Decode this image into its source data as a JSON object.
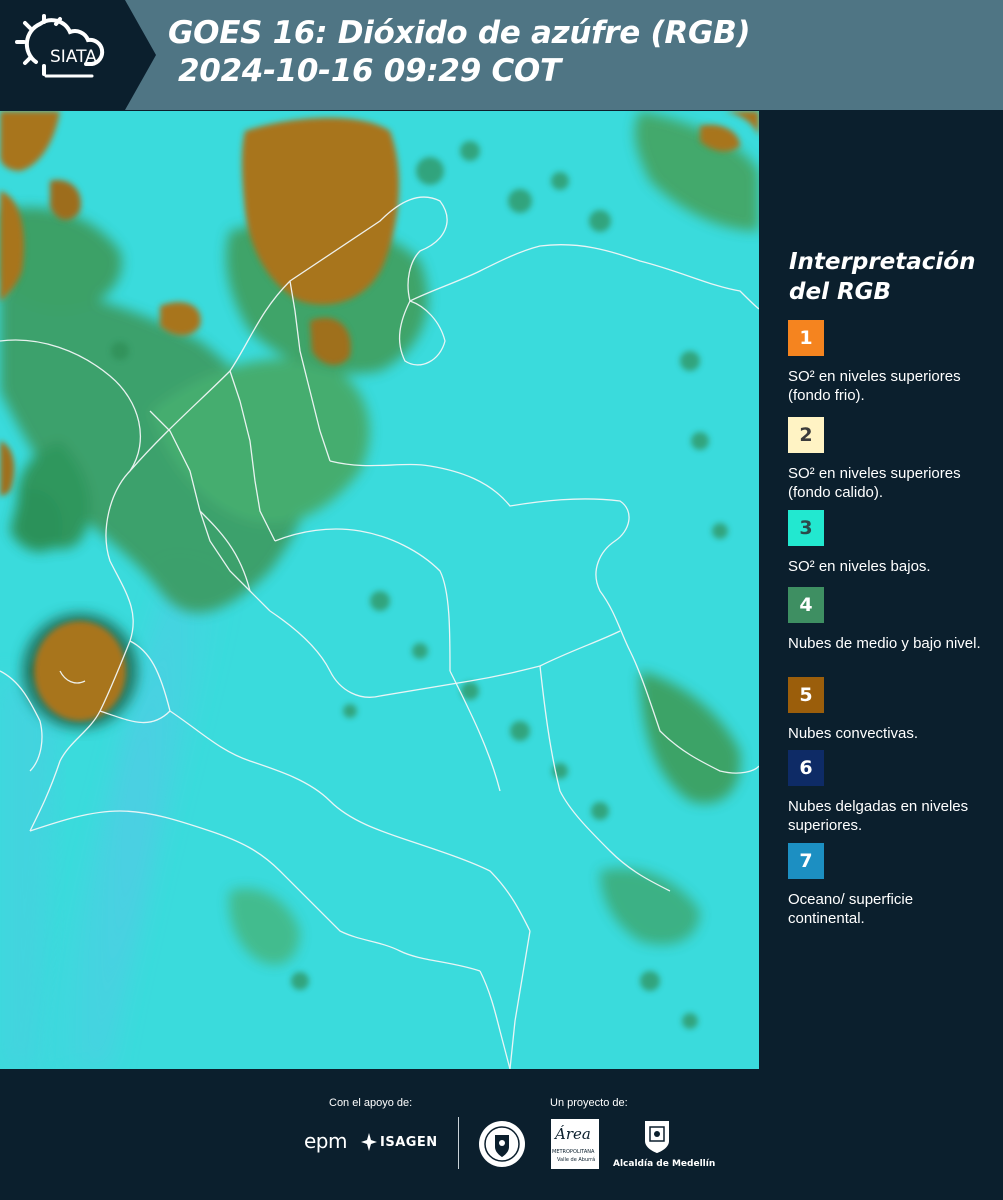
{
  "header": {
    "logo_text": "SIATA",
    "title_line1": "GOES 16: Dióxido de azúfre (RGB)",
    "title_line2": "2024-10-16 09:29 COT"
  },
  "legend": {
    "title": "Interpretación del RGB",
    "items": [
      {
        "number": "1",
        "color": "#f5841f",
        "num_color": "#ffffff",
        "label": "SO² en niveles superiores (fondo frio)."
      },
      {
        "number": "2",
        "color": "#fff3c4",
        "num_color": "#3b3b3b",
        "label": "SO² en niveles superiores (fondo calido)."
      },
      {
        "number": "3",
        "color": "#22e8d0",
        "num_color": "#2b4a4a",
        "label": "SO² en niveles bajos."
      },
      {
        "number": "4",
        "color": "#3e8f62",
        "num_color": "#ffffff",
        "label": "Nubes de medio y bajo nivel."
      },
      {
        "number": "5",
        "color": "#9b5e0b",
        "num_color": "#ffffff",
        "label": "Nubes convectivas."
      },
      {
        "number": "6",
        "color": "#0e2b66",
        "num_color": "#ffffff",
        "label": "Nubes delgadas en niveles superiores."
      },
      {
        "number": "7",
        "color": "#1c8fc2",
        "num_color": "#ffffff",
        "label": "Oceano/ superficie continental."
      }
    ]
  },
  "footer": {
    "support_label": "Con el apoyo de:",
    "project_label": "Un proyecto de:",
    "sponsor_epm": "epm",
    "sponsor_isagen": "ISAGEN",
    "partner_area": "Área",
    "partner_area_sub": "METROPOLITANA",
    "partner_area_sub2": "Valle de Aburrá",
    "partner_alcaldia": "Alcaldía de Medellín"
  }
}
